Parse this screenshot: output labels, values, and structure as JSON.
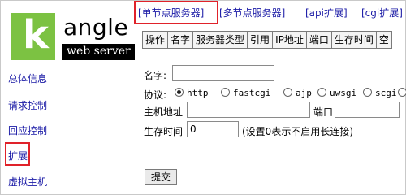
{
  "logo": {
    "letter": "k",
    "word": "angle",
    "subtitle": "web server"
  },
  "sidebar": {
    "items": [
      {
        "label": "总体信息"
      },
      {
        "label": "请求控制"
      },
      {
        "label": "回应控制"
      },
      {
        "label": "扩展"
      },
      {
        "label": "虚拟主机"
      }
    ]
  },
  "top_links": [
    {
      "label": "[单节点服务器]"
    },
    {
      "label": "[多节点服务器]"
    },
    {
      "label": "[api扩展]"
    },
    {
      "label": "[cgi扩展]"
    }
  ],
  "table": {
    "headers": [
      "操作",
      "名字",
      "服务器类型",
      "引用",
      "IP地址",
      "端口",
      "生存时间",
      "空"
    ]
  },
  "form": {
    "name_label": "名字:",
    "name_value": "",
    "protocol_label": "协议:",
    "protocol_options": [
      "http",
      "fastcgi",
      "ajp",
      "uwsgi",
      "scgi"
    ],
    "protocol_selected": "http",
    "host_label": "主机地址",
    "host_value": "",
    "port_label": "端口",
    "port_value": "",
    "ttl_label": "生存时间",
    "ttl_value": "0",
    "ttl_hint": "(设置0表示不启用长连接)",
    "submit_label": "提交"
  },
  "colors": {
    "link": "#1a1aa6",
    "highlight": "#e0222a",
    "logo_green": "#7cc242"
  }
}
